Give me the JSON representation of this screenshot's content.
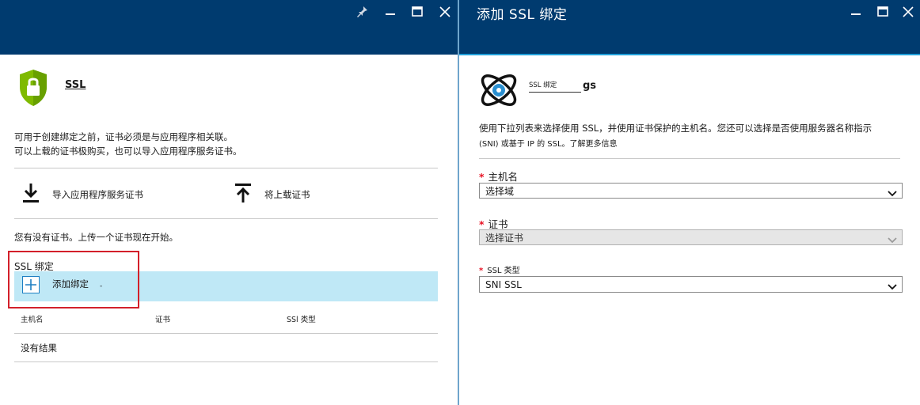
{
  "left_blade": {
    "title": "SSL",
    "description_line1": "可用于创建绑定之前，证书必须是与应用程序相关联。",
    "description_line2": "可以上载的证书极购买，也可以导入应用程序服务证书。",
    "actions": {
      "import_label": "导入应用程序服务证书",
      "upload_label": "将上载证书"
    },
    "no_cert_text": "您有没有证书。上传一个证书现在开始。",
    "bindings_section_title": "SSL 绑定",
    "add_binding_label": "添加绑定",
    "add_binding_trailing": "-",
    "table": {
      "columns": [
        "主机名",
        "证书",
        "SSl 类型"
      ],
      "empty_text": "没有结果"
    }
  },
  "right_blade": {
    "header_title": "添加 SSL 绑定",
    "resource_label": "SSL 绑定",
    "resource_name": "gs",
    "description_line1": "使用下拉列表来选择使用 SSL，并使用证书保护的主机名。您还可以选择是否使用服务器名称指示",
    "description_line2": "(SNI) 或基于 IP 的 SSL。了解更多信息",
    "fields": {
      "hostname_label": "主机名",
      "hostname_value": "选择域",
      "certificate_label": "证书",
      "certificate_value": "选择证书",
      "ssl_type_label": "SSL 类型",
      "ssl_type_value": "SNI SSL"
    },
    "required_marker": "*"
  },
  "colors": {
    "header_bg": "#003b6f",
    "accent_line": "#20a0da",
    "shield_green": "#7fba00",
    "add_row_bg": "#bfe8f6",
    "required_red": "#e81123",
    "highlight_red": "#d3202a"
  },
  "icons": [
    "pin-icon",
    "minimize-icon",
    "maximize-icon",
    "close-icon",
    "shield-lock-icon",
    "download-icon",
    "upload-icon",
    "plus-icon",
    "ssl-orbit-icon",
    "chevron-down-icon"
  ]
}
